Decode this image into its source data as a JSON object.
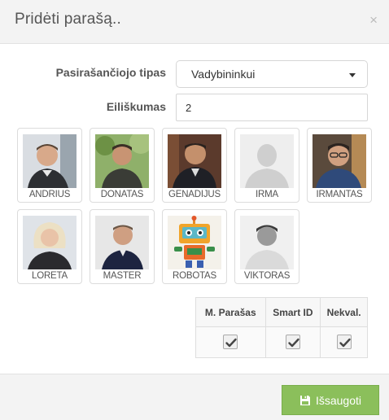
{
  "dialog": {
    "title": "Pridėti parašą..",
    "close_glyph": "×"
  },
  "form": {
    "signer_type_label": "Pasirašančiojo tipas",
    "signer_type_value": "Vadybininkui",
    "order_label": "Eiliškumas",
    "order_value": "2"
  },
  "users": [
    {
      "name": "ANDRIUS",
      "icon": "person-photo"
    },
    {
      "name": "DONATAS",
      "icon": "person-photo"
    },
    {
      "name": "GENADIJUS",
      "icon": "person-photo"
    },
    {
      "name": "IRMA",
      "icon": "avatar-placeholder"
    },
    {
      "name": "IRMANTAS",
      "icon": "person-photo"
    },
    {
      "name": "LORETA",
      "icon": "person-photo"
    },
    {
      "name": "MASTER",
      "icon": "person-photo"
    },
    {
      "name": "ROBOTAS",
      "icon": "robot-photo"
    },
    {
      "name": "VIKTORAS",
      "icon": "person-photo"
    }
  ],
  "permissions": {
    "headers": [
      "M. Parašas",
      "Smart ID",
      "Nekval."
    ],
    "checked": [
      true,
      true,
      true
    ]
  },
  "footer": {
    "save_label": "Išsaugoti",
    "save_icon": "floppy-disk-icon"
  },
  "colors": {
    "header_bg": "#f3f3f3",
    "save_button": "#8bbf5b",
    "border": "#dcdcdc"
  }
}
